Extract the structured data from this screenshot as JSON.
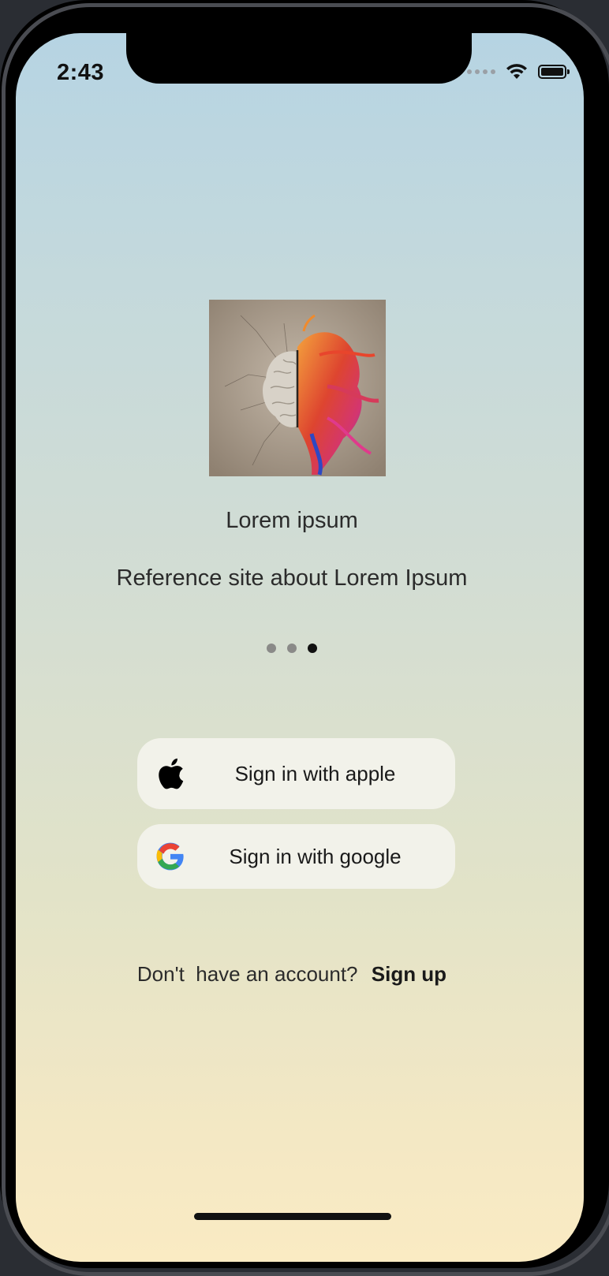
{
  "status_bar": {
    "time": "2:43",
    "icons": [
      "cellular-signal-icon",
      "wifi-icon",
      "battery-icon"
    ]
  },
  "onboarding": {
    "image": "brain-illustration",
    "title": "Lorem ipsum",
    "subtitle": "Reference site about Lorem Ipsum",
    "page_indicator": {
      "total": 3,
      "current": 3
    }
  },
  "auth": {
    "apple_label": "Sign in with apple",
    "google_label": "Sign in with google",
    "signup_prompt": "Don't  have an account?",
    "signup_link": "Sign up"
  },
  "colors": {
    "gradient_top": "#b6d4e3",
    "gradient_bottom": "#faebc3",
    "button_bg": "#f2f2ea",
    "text": "#2b2b2b"
  }
}
